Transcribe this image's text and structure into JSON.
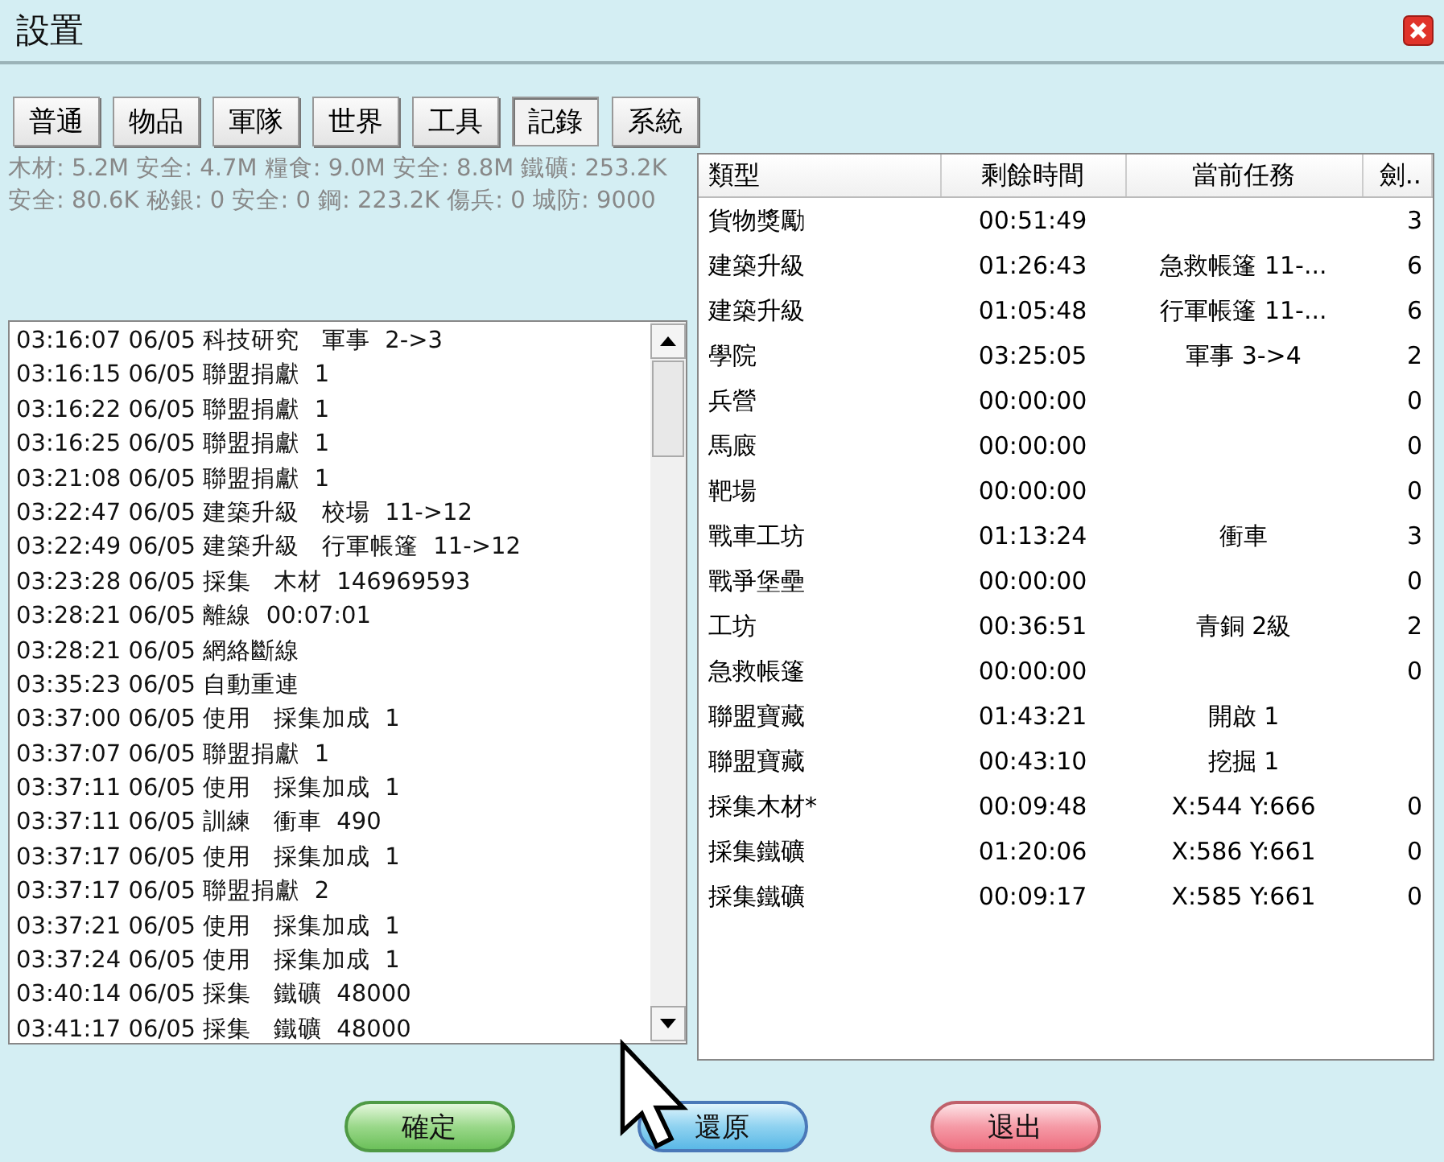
{
  "window": {
    "title": "設置"
  },
  "tabs": [
    {
      "label": "普通",
      "selected": false
    },
    {
      "label": "物品",
      "selected": false
    },
    {
      "label": "軍隊",
      "selected": false
    },
    {
      "label": "世界",
      "selected": false
    },
    {
      "label": "工具",
      "selected": false
    },
    {
      "label": "記錄",
      "selected": true
    },
    {
      "label": "系統",
      "selected": false
    }
  ],
  "stats": "木材: 5.2M 安全: 4.7M  糧食: 9.0M 安全: 8.8M 鐵礦: 253.2K 安全: 80.6K  秘銀: 0 安全: 0  鋼: 223.2K  傷兵: 0  城防: 9000",
  "log": [
    {
      "time": "03:16:07",
      "date": "06/05",
      "event": "科技研究",
      "detail": "軍事",
      "value": "2->3"
    },
    {
      "time": "03:16:15",
      "date": "06/05",
      "event": "聯盟捐獻",
      "value": "1"
    },
    {
      "time": "03:16:22",
      "date": "06/05",
      "event": "聯盟捐獻",
      "value": "1"
    },
    {
      "time": "03:16:25",
      "date": "06/05",
      "event": "聯盟捐獻",
      "value": "1"
    },
    {
      "time": "03:21:08",
      "date": "06/05",
      "event": "聯盟捐獻",
      "value": "1"
    },
    {
      "time": "03:22:47",
      "date": "06/05",
      "event": "建築升級",
      "detail": "校場",
      "value": "11->12"
    },
    {
      "time": "03:22:49",
      "date": "06/05",
      "event": "建築升級",
      "detail": "行軍帳篷",
      "value": "11->12"
    },
    {
      "time": "03:23:28",
      "date": "06/05",
      "event": "採集",
      "detail": "木材",
      "value": "146969593"
    },
    {
      "time": "03:28:21",
      "date": "06/05",
      "event": "離線",
      "value": "00:07:01"
    },
    {
      "time": "03:28:21",
      "date": "06/05",
      "event": "網絡斷線"
    },
    {
      "time": "03:35:23",
      "date": "06/05",
      "event": "自動重連"
    },
    {
      "time": "03:37:00",
      "date": "06/05",
      "event": "使用",
      "detail": "採集加成",
      "value": "1"
    },
    {
      "time": "03:37:07",
      "date": "06/05",
      "event": "聯盟捐獻",
      "value": "1"
    },
    {
      "time": "03:37:11",
      "date": "06/05",
      "event": "使用",
      "detail": "採集加成",
      "value": "1"
    },
    {
      "time": "03:37:11",
      "date": "06/05",
      "event": "訓練",
      "detail": "衝車",
      "value": "490"
    },
    {
      "time": "03:37:17",
      "date": "06/05",
      "event": "使用",
      "detail": "採集加成",
      "value": "1"
    },
    {
      "time": "03:37:17",
      "date": "06/05",
      "event": "聯盟捐獻",
      "value": "2"
    },
    {
      "time": "03:37:21",
      "date": "06/05",
      "event": "使用",
      "detail": "採集加成",
      "value": "1"
    },
    {
      "time": "03:37:24",
      "date": "06/05",
      "event": "使用",
      "detail": "採集加成",
      "value": "1"
    },
    {
      "time": "03:40:14",
      "date": "06/05",
      "event": "採集",
      "detail": "鐵礦",
      "value": "48000"
    },
    {
      "time": "03:41:17",
      "date": "06/05",
      "event": "採集",
      "detail": "鐵礦",
      "value": "48000"
    }
  ],
  "table": {
    "columns": [
      "類型",
      "剩餘時間",
      "當前任務",
      "劍.."
    ],
    "rows": [
      [
        "貨物獎勵",
        "00:51:49",
        "",
        "3"
      ],
      [
        "建築升級",
        "01:26:43",
        "急救帳篷 11-...",
        "6"
      ],
      [
        "建築升級",
        "01:05:48",
        "行軍帳篷 11-...",
        "6"
      ],
      [
        "學院",
        "03:25:05",
        "軍事 3->4",
        "2"
      ],
      [
        "兵營",
        "00:00:00",
        "",
        "0"
      ],
      [
        "馬廄",
        "00:00:00",
        "",
        "0"
      ],
      [
        "靶場",
        "00:00:00",
        "",
        "0"
      ],
      [
        "戰車工坊",
        "01:13:24",
        "衝車",
        "3"
      ],
      [
        "戰爭堡壘",
        "00:00:00",
        "",
        "0"
      ],
      [
        "工坊",
        "00:36:51",
        "青銅 2級",
        "2"
      ],
      [
        "急救帳篷",
        "00:00:00",
        "",
        "0"
      ],
      [
        "聯盟寶藏",
        "01:43:21",
        "開啟 1",
        ""
      ],
      [
        "聯盟寶藏",
        "00:43:10",
        "挖掘 1",
        ""
      ],
      [
        "採集木材*",
        "00:09:48",
        "X:544 Y:666",
        "0"
      ],
      [
        "採集鐵礦",
        "01:20:06",
        "X:586 Y:661",
        "0"
      ],
      [
        "採集鐵礦",
        "00:09:17",
        "X:585 Y:661",
        "0"
      ]
    ]
  },
  "buttons": [
    {
      "label": "確定",
      "kind": "ok"
    },
    {
      "label": "還原",
      "kind": "reset"
    },
    {
      "label": "退出",
      "kind": "exit"
    }
  ]
}
